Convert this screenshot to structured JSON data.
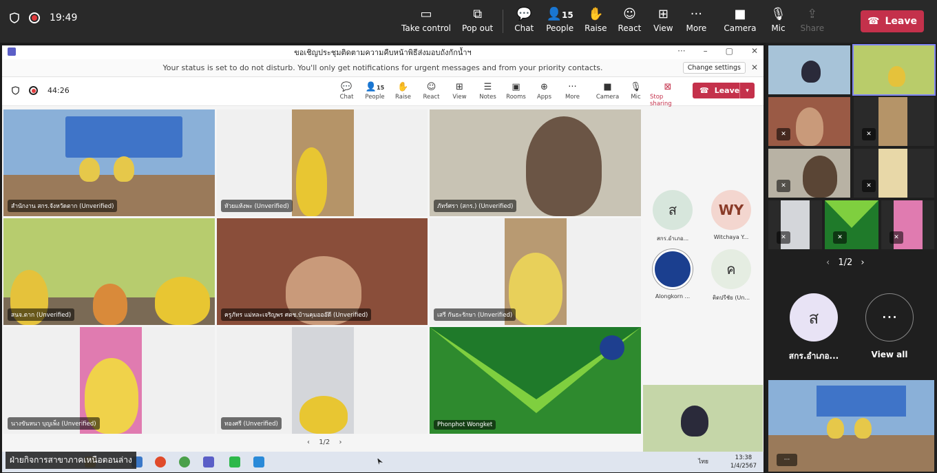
{
  "topbar": {
    "time": "19:49",
    "buttons": [
      {
        "icon": "take-control-icon",
        "label": "Take control"
      },
      {
        "icon": "pop-out-icon",
        "label": "Pop out"
      },
      {
        "icon": "chat-icon",
        "label": "Chat"
      },
      {
        "icon": "people-icon",
        "label": "People",
        "badge": "15"
      },
      {
        "icon": "raise-hand-icon",
        "label": "Raise"
      },
      {
        "icon": "react-icon",
        "label": "React"
      },
      {
        "icon": "view-icon",
        "label": "View"
      },
      {
        "icon": "more-icon",
        "label": "More"
      },
      {
        "icon": "camera-icon",
        "label": "Camera"
      },
      {
        "icon": "mic-icon",
        "label": "Mic"
      },
      {
        "icon": "share-icon",
        "label": "Share"
      }
    ],
    "leave": "Leave"
  },
  "window": {
    "title": "ขอเชิญประชุมติดตามความคืบหน้าพิธีส่งมอบถังกักน้ำฯ",
    "banner": "Your status is set to do not disturb. You'll only get notifications for urgent messages and from your priority contacts.",
    "change_settings": "Change settings",
    "timer": "44:26",
    "toolbar": [
      {
        "icon": "chat-icon",
        "label": "Chat"
      },
      {
        "icon": "people-icon",
        "label": "People",
        "badge": "15"
      },
      {
        "icon": "raise-hand-icon",
        "label": "Raise"
      },
      {
        "icon": "react-icon",
        "label": "React"
      },
      {
        "icon": "view-icon",
        "label": "View"
      },
      {
        "icon": "notes-icon",
        "label": "Notes"
      },
      {
        "icon": "rooms-icon",
        "label": "Rooms"
      },
      {
        "icon": "apps-icon",
        "label": "Apps"
      },
      {
        "icon": "more-icon",
        "label": "More"
      },
      {
        "icon": "camera-icon",
        "label": "Camera"
      },
      {
        "icon": "mic-icon",
        "label": "Mic"
      },
      {
        "icon": "stop-sharing-icon",
        "label": "Stop sharing"
      }
    ],
    "leave": "Leave"
  },
  "tiles": [
    {
      "name": "สำนักงาน สกร.จังหวัดตาก (Unverified)"
    },
    {
      "name": "หัวยแห้งพะ (Unverified)"
    },
    {
      "name": "ภัทร์ศรา (สกร.) (Unverified)"
    },
    {
      "name": "สนจ.ตาก (Unverified)"
    },
    {
      "name": "ครูภัทร แม่หละเจริญพร ศตช.บ้านคุมอออ๊ดี (Unverified)"
    },
    {
      "name": "เสรี กันธะรักษา (Unverified)"
    },
    {
      "name": "นางขันหนา บุญเพ็ง (Unverified)"
    },
    {
      "name": "ทองศรี (Unverified)"
    },
    {
      "name": "Phonphot Wongket"
    }
  ],
  "avatars": [
    {
      "initial": "ส",
      "label": "สกร.อำเภอ...",
      "color": "#d7e6dc"
    },
    {
      "initial": "WY",
      "label": "Witchaya Y...",
      "color": "#f3d6cf"
    },
    {
      "initial": "",
      "label": "Alongkorn ...",
      "color": "#1b3f8f"
    },
    {
      "initial": "ค",
      "label": "ติดปรีชัย (Un...",
      "color": "#e5ede2"
    }
  ],
  "pager": "1/2",
  "right_panel": {
    "pager": "1/2",
    "avatar": {
      "initial": "ส",
      "label": "สกร.อำเภอ..."
    },
    "view_all": "View all"
  },
  "taskbar": {
    "caption": "ฝ่ายกิจการสาขาภาคเหนือตอนล่าง",
    "clock": "13:38",
    "date": "1/4/2567",
    "lang": "ไทย"
  },
  "colors": {
    "accent": "#5b5fc7",
    "leave": "#c4314b",
    "topbar": "#292929"
  }
}
